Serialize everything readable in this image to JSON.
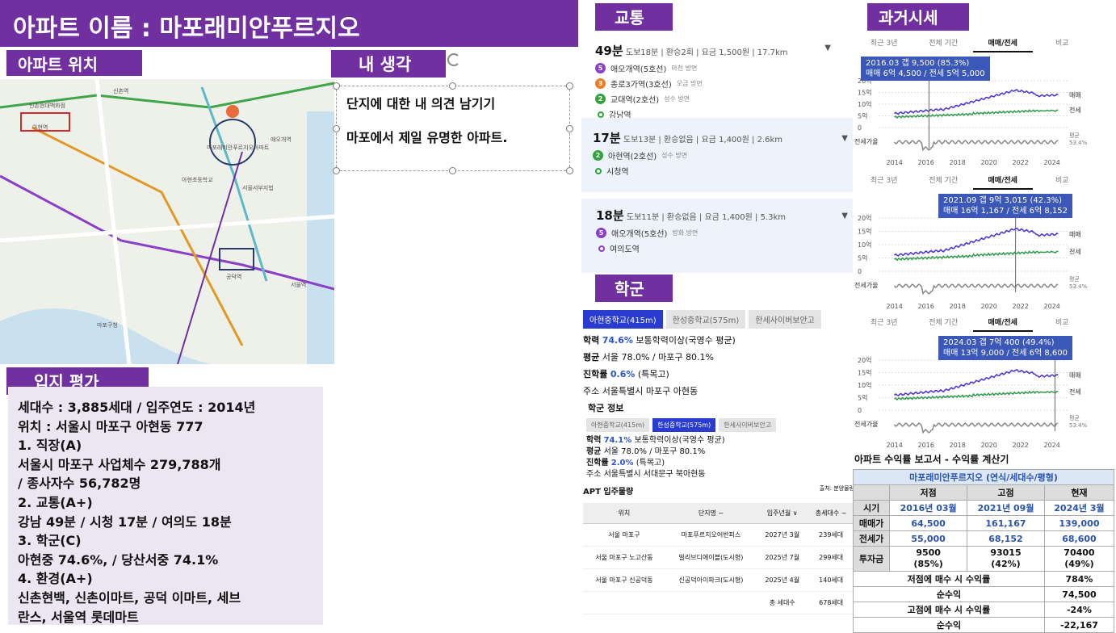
{
  "title": "아파트 이름 : 마포래미안푸르지오",
  "labels": {
    "location": "아파트 위치",
    "my_opinion": "내 생각",
    "evaluation": "입지 평가",
    "transport": "교통",
    "school": "학군",
    "past_price": "과거시세"
  },
  "opinion_lines": [
    "단지에 대한 내 의견 남기기",
    "마포에서 제일 유명한 아파트."
  ],
  "evaluation_lines": [
    "세대수 : 3,885세대 / 입주연도 : 2014년",
    "위치 : 서울시 마포구 아현동 777",
    "1. 직장(A)",
    "서울시 마포구 사업체수 279,788개",
    "/ 종사자수 56,782명",
    "2. 교통(A+)",
    "강남 49분 / 시청 17분 / 여의도 18분",
    "3. 학군(C)",
    "아현중 74.6%, / 당산서중 74.1%",
    "4. 환경(A+)",
    "신촌현백, 신촌이마트, 공덕 이마트, 세브",
    "란스, 서울역 롯데마트"
  ],
  "map_labels": [
    "신촌현대백화점",
    "아현역",
    "마포래미안푸르지오아파트",
    "공덕역",
    "애오개역",
    "서울역",
    "마포구청",
    "신촌역",
    "서울서부지법",
    "아현초등학교"
  ],
  "routes": [
    {
      "minutes": "49분",
      "meta": "도보18분 | 환승2회 | 요금 1,500원 | 17.7km",
      "stops": [
        {
          "badge": "5",
          "color": "#8b3fc9",
          "name": "애오개역(5호선)",
          "dir": "마천 방면"
        },
        {
          "badge": "3",
          "color": "#ef7c1c",
          "name": "종로3가역(3호선)",
          "dir": "오금 방면"
        },
        {
          "badge": "2",
          "color": "#33a23d",
          "name": "교대역(2호선)",
          "dir": "성수 방면"
        },
        {
          "badge": "",
          "color": "#33a23d",
          "name": "강남역",
          "dir": ""
        }
      ]
    },
    {
      "minutes": "17분",
      "meta": "도보13분 | 환승없음 | 요금 1,400원 | 2.6km",
      "stops": [
        {
          "badge": "2",
          "color": "#33a23d",
          "name": "아현역(2호선)",
          "dir": "성수 방면"
        },
        {
          "badge": "",
          "color": "#33a23d",
          "name": "시청역",
          "dir": ""
        }
      ]
    },
    {
      "minutes": "18분",
      "meta": "도보11분 | 환승없음 | 요금 1,400원 | 5.3km",
      "stops": [
        {
          "badge": "5",
          "color": "#8b3fc9",
          "name": "애오개역(5호선)",
          "dir": "방화 방면"
        },
        {
          "badge": "",
          "color": "#8b3fc9",
          "name": "여의도역",
          "dir": ""
        }
      ]
    }
  ],
  "school": {
    "tabs_top": [
      "아현중학교(415m)",
      "한성중학교(575m)",
      "한세사이버보안고"
    ],
    "block1": {
      "rate_label": "학력",
      "rate": "74.6%",
      "rate_desc": "보통학력이상(국영수 평균)",
      "avg_label": "평균",
      "avg": "서울 78.0% / 마포구 80.1%",
      "adv_label": "진학률",
      "adv": "0.6%",
      "adv_desc": "(특목고)",
      "addr_label": "주소",
      "addr": "서울특별시 마포구 아현동"
    },
    "info_title": "학군 정보",
    "tabs_bottom": [
      "아현중학교(415m)",
      "한성중학교(575m)",
      "한세사이버보안고"
    ],
    "block2": {
      "rate_label": "학력",
      "rate": "74.1%",
      "rate_desc": "보통학력이상(국영수 평균)",
      "avg_label": "평균",
      "avg": "서울 78.0% / 마포구 80.1%",
      "adv_label": "진학률",
      "adv": "2.0%",
      "adv_desc": "(특목고)",
      "addr_label": "주소",
      "addr": "서울특별시 서대문구 북아현동"
    }
  },
  "apt_supply": {
    "title": "APT 입주물량",
    "source": "출처: 분양물량",
    "headers": [
      "위치",
      "단지명 ~",
      "입주년월 ∨",
      "총세대수 ~"
    ],
    "rows": [
      [
        "서울 마포구",
        "마포푸르지오어반피스",
        "2027년 3월",
        "239세대"
      ],
      [
        "서울 마포구 노고산동",
        "빌리브디에이블(도시형)",
        "2025년 7월",
        "299세대"
      ],
      [
        "서울 마포구 신공덕동",
        "신공덕아이파크(도시형)",
        "2025년 4월",
        "140세대"
      ],
      [
        "",
        "",
        "총 세대수",
        "678세대"
      ]
    ]
  },
  "price_charts": [
    {
      "tabs": [
        "최근 3년",
        "전체 기간",
        "매매/전세",
        "비교"
      ],
      "tooltip1": "2016.03 갭 9,500 (85.3%)",
      "tooltip2": "매매 6억 4,500 / 전세 5억 5,000",
      "y_ticks": [
        "20억",
        "15억",
        "10억",
        "5억",
        "0"
      ],
      "x_ticks": [
        "2014",
        "2016",
        "2018",
        "2020",
        "2022",
        "2024"
      ],
      "gap_label": "전세가율",
      "legend_sale": "매매",
      "legend_jeonse": "전세",
      "ratio_label": "평균",
      "ratio": "53.4%",
      "marker_year": 2016.2
    },
    {
      "tabs": [
        "최근 3년",
        "전체 기간",
        "매매/전세",
        "비교"
      ],
      "tooltip1": "2021.09 갭 9억 3,015 (42.3%)",
      "tooltip2": "매매 16억 1,167 / 전세 6억 8,152",
      "y_ticks": [
        "20억",
        "15억",
        "10억",
        "5억",
        "0"
      ],
      "x_ticks": [
        "2014",
        "2016",
        "2018",
        "2020",
        "2022",
        "2024"
      ],
      "gap_label": "전세가율",
      "legend_sale": "매매",
      "legend_jeonse": "전세",
      "ratio_label": "평균",
      "ratio": "53.4%",
      "marker_year": 2021.7
    },
    {
      "tabs": [
        "최근 3년",
        "전체 기간",
        "매매/전세",
        "비교"
      ],
      "tooltip1": "2024.03 갭 7억 400 (49.4%)",
      "tooltip2": "매매 13억 9,000 / 전세 6억 8,600",
      "y_ticks": [
        "20억",
        "15억",
        "10억",
        "5억",
        "0"
      ],
      "x_ticks": [
        "2014",
        "2016",
        "2018",
        "2020",
        "2022",
        "2024"
      ],
      "gap_label": "전세가율",
      "legend_sale": "매매",
      "legend_jeonse": "전세",
      "ratio_label": "평균",
      "ratio": "53.4%",
      "marker_year": 2024.2
    }
  ],
  "roi": {
    "title": "아파트 수익률 보고서 - 수익률 계산기",
    "subtitle": "마포래미안푸르지오 (연식/세대수/평형)",
    "cols": [
      "",
      "저점",
      "고점",
      "현재"
    ],
    "rows": [
      [
        "시기",
        "2016년 03월",
        "2021년 09월",
        "2024년 3월"
      ],
      [
        "매매가",
        "64,500",
        "161,167",
        "139,000"
      ],
      [
        "전세가",
        "55,000",
        "68,152",
        "68,600"
      ],
      [
        "투자금",
        "9500\n(85%)",
        "93015\n(42%)",
        "70400\n(49%)"
      ]
    ],
    "summary": [
      [
        "저점에 매수 시 수익률",
        "784%"
      ],
      [
        "순수익",
        "74,500"
      ],
      [
        "고점에 매수 시 수익률",
        "-24%"
      ],
      [
        "순수익",
        "-22,167"
      ]
    ]
  },
  "colors": {
    "accent": "#7030a0",
    "sale_line": "#4b2fd6",
    "jeonse_line": "#2f9a4a",
    "gap_line": "#888888"
  }
}
